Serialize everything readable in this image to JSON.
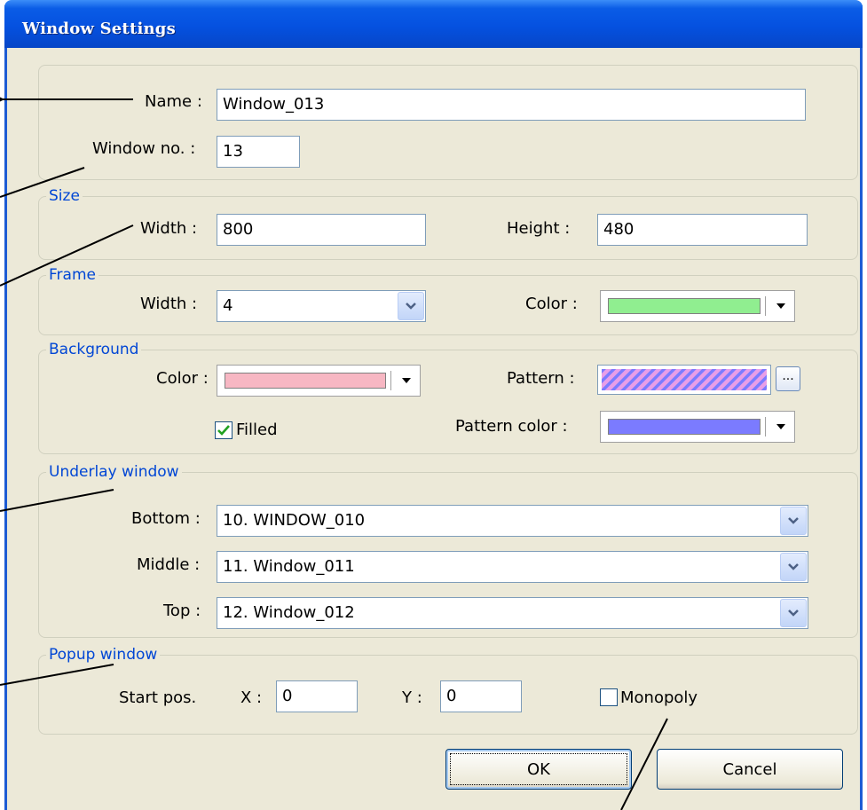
{
  "window": {
    "title": "Window Settings"
  },
  "general": {
    "name_label": "Name :",
    "name_value": "Window_013",
    "window_no_label": "Window no. :",
    "window_no_value": "13"
  },
  "size": {
    "legend": "Size",
    "width_label": "Width :",
    "width_value": "800",
    "height_label": "Height :",
    "height_value": "480"
  },
  "frame": {
    "legend": "Frame",
    "width_label": "Width :",
    "width_value": "4",
    "color_label": "Color :",
    "color": "#90ee90"
  },
  "background": {
    "legend": "Background",
    "color_label": "Color :",
    "color": "#f7b7c3",
    "pattern_label": "Pattern :",
    "pattern_color_label": "Pattern color :",
    "pattern_color": "#7b7bff",
    "pattern_button": "...",
    "filled_label": "Filled",
    "filled_checked": true
  },
  "underlay": {
    "legend": "Underlay window",
    "bottom_label": "Bottom :",
    "bottom_value": "10. WINDOW_010",
    "middle_label": "Middle :",
    "middle_value": "11. Window_011",
    "top_label": "Top :",
    "top_value": "12. Window_012"
  },
  "popup": {
    "legend": "Popup window",
    "start_pos_label": "Start pos.",
    "x_label": "X :",
    "x_value": "0",
    "y_label": "Y :",
    "y_value": "0",
    "monopoly_label": "Monopoly",
    "monopoly_checked": false
  },
  "buttons": {
    "ok": "OK",
    "cancel": "Cancel"
  },
  "colors": {
    "title_blue": "#0551e0",
    "legend_blue": "#0046d5",
    "dialog_bg": "#ece9d8"
  }
}
